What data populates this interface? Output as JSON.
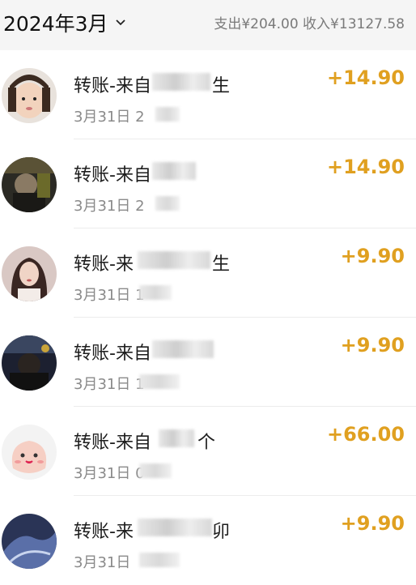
{
  "header": {
    "month": "2024年3月",
    "summary": "支出¥204.00 收入¥13127.58"
  },
  "transactions": [
    {
      "title": "转账-来自",
      "suffix": "生",
      "time": "3月31日 2",
      "amount": "+14.90",
      "avatar": "child-photo"
    },
    {
      "title": "转账-来自",
      "suffix": "",
      "time": "3月31日 2",
      "amount": "+14.90",
      "avatar": "dark-photo"
    },
    {
      "title": "转账-来",
      "suffix": "生",
      "time": "3月31日 1",
      "amount": "+9.90",
      "avatar": "woman-photo"
    },
    {
      "title": "转账-来自",
      "suffix": "",
      "time": "3月31日 1",
      "amount": "+9.90",
      "avatar": "night-photo"
    },
    {
      "title": "转账-来自",
      "suffix": "个",
      "time": "3月31日 0",
      "amount": "+66.00",
      "avatar": "cartoon-pink"
    },
    {
      "title": "转账-来",
      "suffix": "卯",
      "time": "3月31日",
      "amount": "+9.90",
      "avatar": "blue-photo"
    }
  ],
  "colors": {
    "amount": "#e0a020",
    "header_bg": "#f5f5f5"
  }
}
